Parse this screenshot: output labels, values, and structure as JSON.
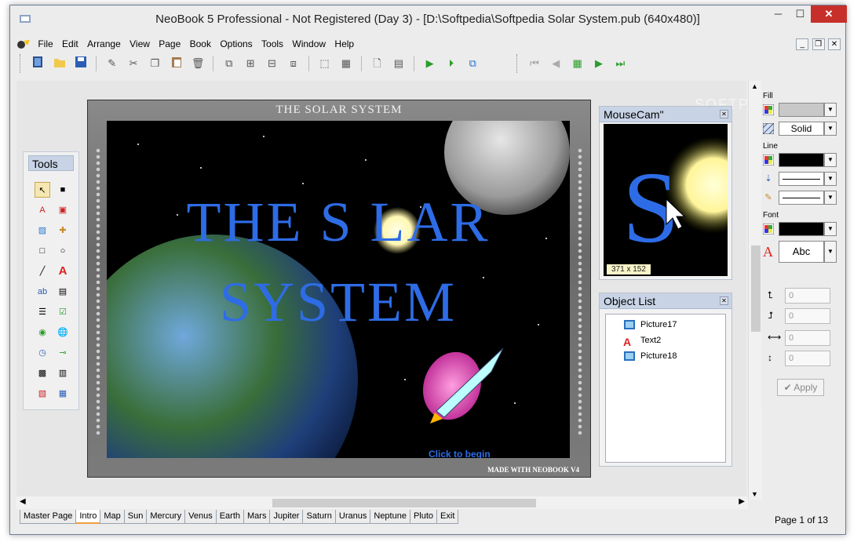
{
  "window": {
    "title": "NeoBook 5 Professional - Not Registered (Day 3) - [D:\\Softpedia\\Softpedia Solar System.pub (640x480)]",
    "controls": {
      "minimize": "─",
      "maximize": "☐",
      "close": "✕"
    }
  },
  "menu": {
    "items": [
      "File",
      "Edit",
      "Arrange",
      "View",
      "Page",
      "Book",
      "Options",
      "Tools",
      "Window",
      "Help"
    ],
    "mdi": {
      "minimize": "_",
      "restore": "❐",
      "close": "✕"
    }
  },
  "tools_panel": {
    "title": "Tools"
  },
  "page": {
    "header": "THE SOLAR SYSTEM",
    "title_line1": "THE S LAR",
    "title_line2": "SYSTEM",
    "click_text": "Click to begin",
    "footer": "MADE WITH NEOBOOK V4"
  },
  "mousecam": {
    "title": "MouseCam\"",
    "size_label": "371 x 152"
  },
  "object_list": {
    "title": "Object List",
    "items": [
      "Picture17",
      "Text2",
      "Picture18"
    ]
  },
  "properties": {
    "fill_label": "Fill",
    "fill_style": "Solid",
    "line_label": "Line",
    "font_label": "Font",
    "font_sample": "Abc",
    "num_values": [
      "0",
      "0",
      "0",
      "0"
    ],
    "apply_label": "Apply"
  },
  "page_tabs": [
    "Master Page",
    "Intro",
    "Map",
    "Sun",
    "Mercury",
    "Venus",
    "Earth",
    "Mars",
    "Jupiter",
    "Saturn",
    "Uranus",
    "Neptune",
    "Pluto",
    "Exit"
  ],
  "active_tab": "Intro",
  "status": {
    "page_indicator": "Page 1 of 13"
  },
  "watermark": "SOFTPEDIA",
  "colors": {
    "title_blue": "#2e6ce6",
    "panel_header": "#c8d4e6",
    "close_red": "#c7302a"
  }
}
